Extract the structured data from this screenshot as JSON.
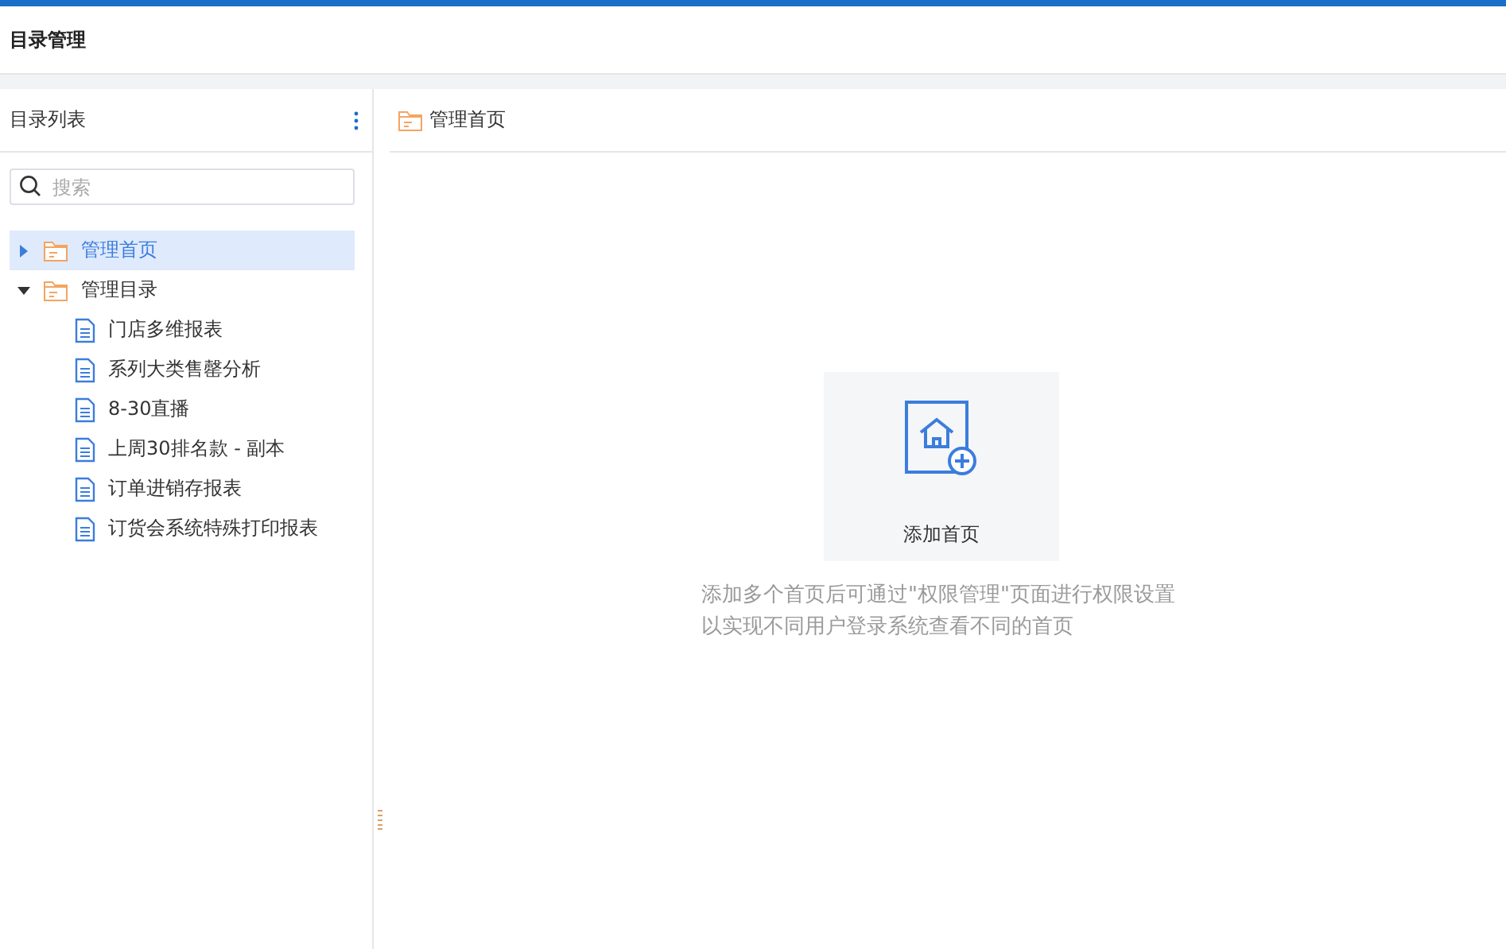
{
  "header": {
    "title": "目录管理"
  },
  "sidebar": {
    "title": "目录列表",
    "search": {
      "placeholder": "搜索"
    },
    "tree": [
      {
        "label": "管理首页",
        "kind": "folder",
        "expanded": false,
        "selected": true
      },
      {
        "label": "管理目录",
        "kind": "folder",
        "expanded": true,
        "selected": false,
        "children": [
          {
            "label": "门店多维报表",
            "kind": "report",
            "selected": false
          },
          {
            "label": "系列大类售罄分析",
            "kind": "report",
            "selected": false
          },
          {
            "label": "8-30直播",
            "kind": "report",
            "selected": false
          },
          {
            "label": "上周30排名款 - 副本",
            "kind": "report",
            "selected": false
          },
          {
            "label": "订单进销存报表",
            "kind": "report",
            "selected": false
          },
          {
            "label": "订货会系统特殊打印报表",
            "kind": "report",
            "selected": false
          }
        ]
      }
    ]
  },
  "main": {
    "breadcrumb": "管理首页",
    "add_card": {
      "label": "添加首页"
    },
    "hint": "添加多个首页后可通过\"权限管理\"页面进行权限设置以实现不同用户登录系统查看不同的首页"
  }
}
